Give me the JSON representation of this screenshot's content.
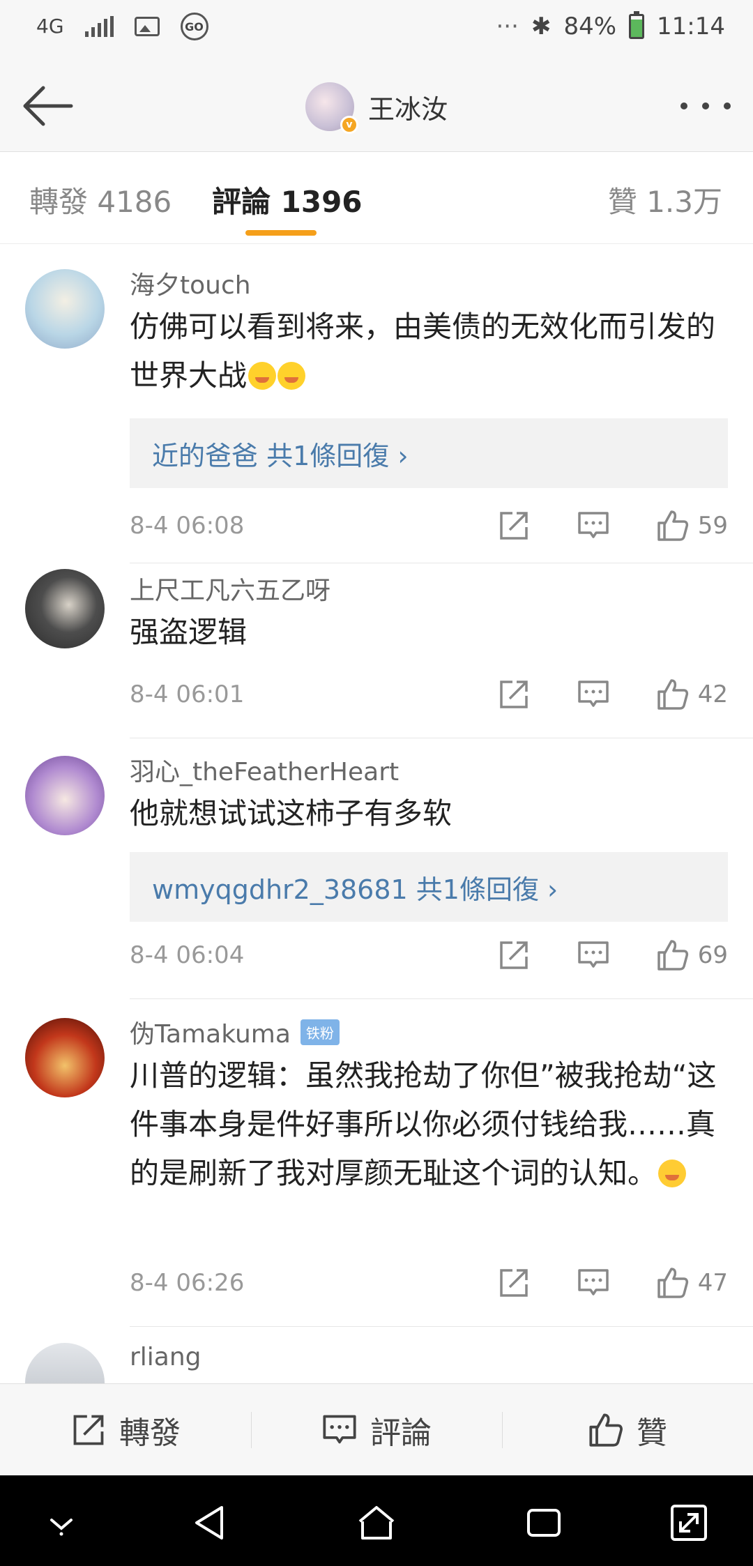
{
  "status_bar": {
    "network": "4G",
    "battery": "84%",
    "time": "11:14",
    "overflow": "···",
    "battery_level": 0.84
  },
  "header": {
    "title": "王冰汝",
    "verified_mark": "v"
  },
  "tabs": {
    "repost": "轉發 4186",
    "comment": "評論 1396",
    "like": "贊 1.3万"
  },
  "comments": [
    {
      "user": "海夕touch",
      "text": "仿佛可以看到将来，由美债的无效化而引发的世界大战",
      "reply": "近的爸爸  共1條回復 ›",
      "time": "8-4 06:08",
      "likes": "59",
      "avatar_color": "#cfe3ef"
    },
    {
      "user": "上尺工凡六五乙呀",
      "text": "强盗逻辑",
      "time": "8-4 06:01",
      "likes": "42",
      "avatar_color": "#3a3a3a"
    },
    {
      "user": "羽心_theFeatherHeart",
      "text": "他就想试试这柿子有多软",
      "reply": "wmyqgdhr2_38681  共1條回復 ›",
      "time": "8-4 06:04",
      "likes": "69",
      "avatar_color": "#7d5aa6"
    },
    {
      "user": "伪Tamakuma",
      "badge": "铁粉",
      "text": "川普的逻辑：虽然我抢劫了你但”被我抢劫“这件事本身是件好事所以你必须付钱给我……真的是刷新了我对厚颜无耻这个词的认知。",
      "time": "8-4 06:26",
      "likes": "47",
      "avatar_color": "#8a1a10"
    },
    {
      "user": "rliang",
      "avatar_color": "#c9cdd2"
    }
  ],
  "action_bar": {
    "repost": "轉發",
    "comment": "評論",
    "like": "贊"
  },
  "icons": {
    "back": "arrow-left-icon",
    "more": "more-dots-icon",
    "share": "share-icon",
    "reply": "comment-icon",
    "like": "thumbs-up-icon"
  }
}
